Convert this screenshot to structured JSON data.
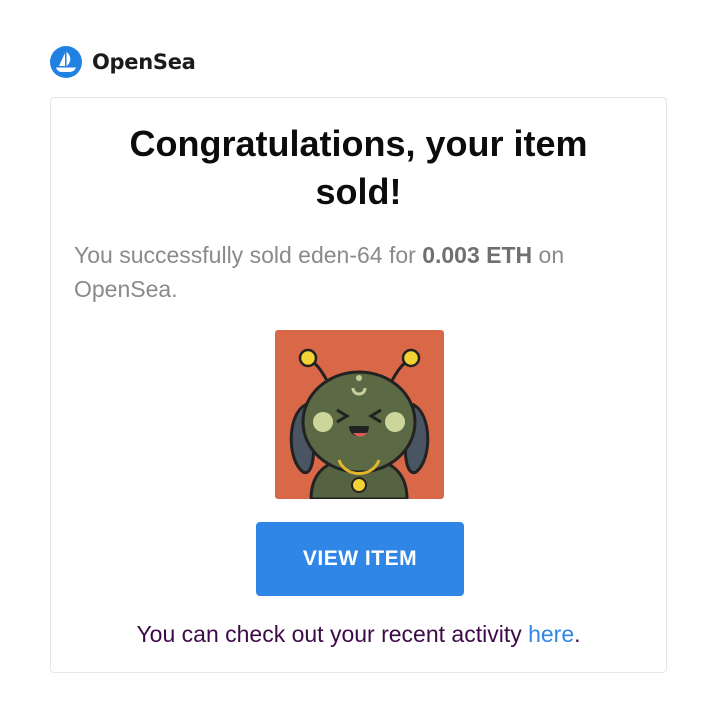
{
  "brand": {
    "name": "OpenSea",
    "logo_icon": "opensea-boat-icon",
    "accent": "#2081e2"
  },
  "card": {
    "title": "Congratulations, your item sold!",
    "message": {
      "prefix": "You successfully sold eden-64 for ",
      "price": "0.003 ETH",
      "suffix": " on OpenSea."
    },
    "image": {
      "description_icon": "nft-creature-image",
      "background": "#d86848"
    },
    "button": {
      "label": "VIEW ITEM",
      "color": "#2f86e6"
    },
    "activity": {
      "text": "You can check out your recent activity ",
      "link": "here",
      "end": "."
    }
  }
}
